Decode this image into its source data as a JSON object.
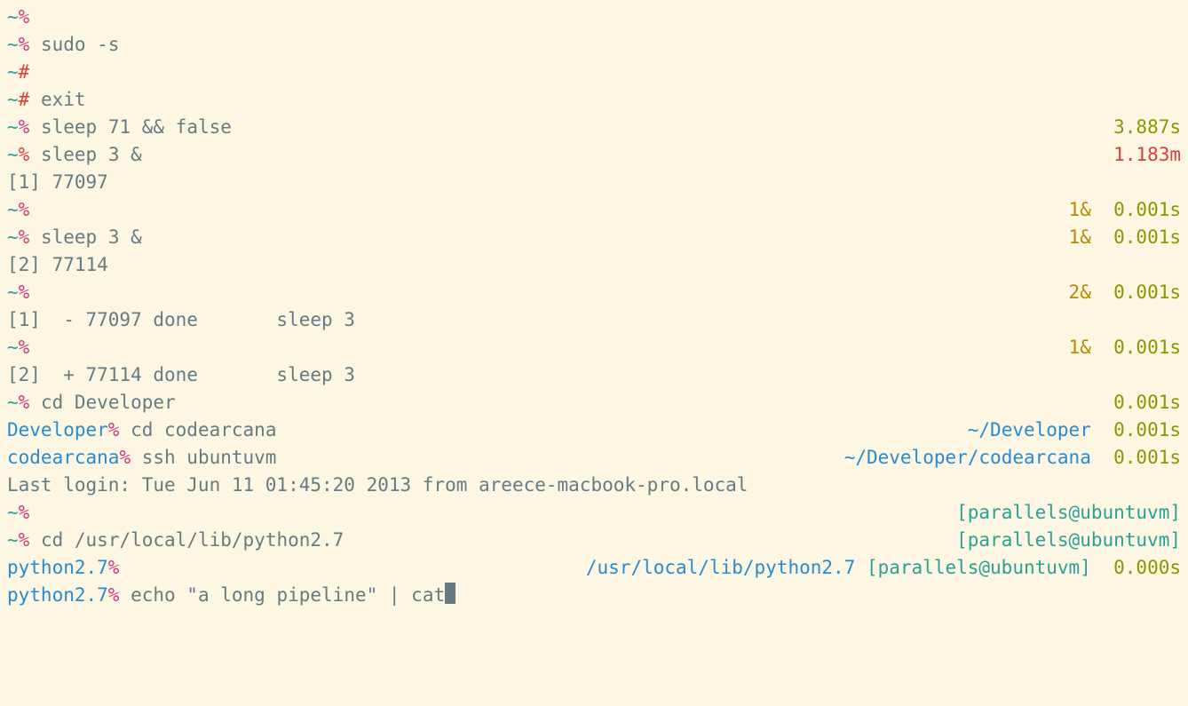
{
  "rows": [
    {
      "left": [
        {
          "t": "~",
          "c": "cyan"
        },
        {
          "t": "%",
          "c": "mag"
        }
      ],
      "right": []
    },
    {
      "left": [
        {
          "t": "~",
          "c": "cyan"
        },
        {
          "t": "%",
          "c": "mag"
        },
        {
          "t": " sudo -s",
          "c": "gray"
        }
      ],
      "right": []
    },
    {
      "left": [
        {
          "t": "~",
          "c": "cyan"
        },
        {
          "t": "#",
          "c": "red"
        }
      ],
      "right": []
    },
    {
      "left": [
        {
          "t": "~",
          "c": "cyan"
        },
        {
          "t": "#",
          "c": "red"
        },
        {
          "t": " exit",
          "c": "gray"
        }
      ],
      "right": []
    },
    {
      "left": [
        {
          "t": "~",
          "c": "cyan"
        },
        {
          "t": "%",
          "c": "mag"
        },
        {
          "t": " sleep 71 && false",
          "c": "gray"
        }
      ],
      "right": [
        {
          "t": "3.887s",
          "c": "olive"
        }
      ]
    },
    {
      "left": [
        {
          "t": "~",
          "c": "cyan"
        },
        {
          "t": "%",
          "c": "red"
        },
        {
          "t": " sleep 3 &",
          "c": "gray"
        }
      ],
      "right": [
        {
          "t": "1.183m",
          "c": "red"
        }
      ]
    },
    {
      "left": [
        {
          "t": "[1] 77097",
          "c": "gray"
        }
      ],
      "right": []
    },
    {
      "left": [
        {
          "t": "~",
          "c": "cyan"
        },
        {
          "t": "%",
          "c": "mag"
        }
      ],
      "right": [
        {
          "t": "1&",
          "c": "yellowish"
        },
        {
          "t": "  ",
          "c": "gray"
        },
        {
          "t": "0.001s",
          "c": "olive"
        }
      ]
    },
    {
      "left": [
        {
          "t": "~",
          "c": "cyan"
        },
        {
          "t": "%",
          "c": "mag"
        },
        {
          "t": " sleep 3 &",
          "c": "gray"
        }
      ],
      "right": [
        {
          "t": "1&",
          "c": "yellowish"
        },
        {
          "t": "  ",
          "c": "gray"
        },
        {
          "t": "0.001s",
          "c": "olive"
        }
      ]
    },
    {
      "left": [
        {
          "t": "[2] 77114",
          "c": "gray"
        }
      ],
      "right": []
    },
    {
      "left": [
        {
          "t": "~",
          "c": "cyan"
        },
        {
          "t": "%",
          "c": "mag"
        }
      ],
      "right": [
        {
          "t": "2&",
          "c": "yellowish"
        },
        {
          "t": "  ",
          "c": "gray"
        },
        {
          "t": "0.001s",
          "c": "olive"
        }
      ]
    },
    {
      "left": [
        {
          "t": "[1]  - 77097 done       sleep 3",
          "c": "gray"
        }
      ],
      "right": []
    },
    {
      "left": [
        {
          "t": "~",
          "c": "cyan"
        },
        {
          "t": "%",
          "c": "mag"
        }
      ],
      "right": [
        {
          "t": "1&",
          "c": "yellowish"
        },
        {
          "t": "  ",
          "c": "gray"
        },
        {
          "t": "0.001s",
          "c": "olive"
        }
      ]
    },
    {
      "left": [
        {
          "t": "[2]  + 77114 done       sleep 3",
          "c": "gray"
        }
      ],
      "right": []
    },
    {
      "left": [
        {
          "t": "~",
          "c": "cyan"
        },
        {
          "t": "%",
          "c": "mag"
        },
        {
          "t": " cd Developer",
          "c": "gray"
        }
      ],
      "right": [
        {
          "t": "0.001s",
          "c": "olive"
        }
      ]
    },
    {
      "left": [
        {
          "t": "Developer",
          "c": "blue"
        },
        {
          "t": "%",
          "c": "mag"
        },
        {
          "t": " cd codearcana",
          "c": "gray"
        }
      ],
      "right": [
        {
          "t": "~/Developer",
          "c": "blue"
        },
        {
          "t": "  ",
          "c": "gray"
        },
        {
          "t": "0.001s",
          "c": "olive"
        }
      ]
    },
    {
      "left": [
        {
          "t": "codearcana",
          "c": "blue"
        },
        {
          "t": "%",
          "c": "mag"
        },
        {
          "t": " ssh ubuntuvm",
          "c": "gray"
        }
      ],
      "right": [
        {
          "t": "~/Developer/codearcana",
          "c": "blue"
        },
        {
          "t": "  ",
          "c": "gray"
        },
        {
          "t": "0.001s",
          "c": "olive"
        }
      ]
    },
    {
      "left": [
        {
          "t": "Last login: Tue Jun 11 01:45:20 2013 from areece-macbook-pro.local",
          "c": "gray"
        }
      ],
      "right": []
    },
    {
      "left": [
        {
          "t": "~",
          "c": "cyan"
        },
        {
          "t": "%",
          "c": "mag"
        }
      ],
      "right": [
        {
          "t": "[parallels@ubuntuvm]",
          "c": "cyan"
        }
      ]
    },
    {
      "left": [
        {
          "t": "~",
          "c": "cyan"
        },
        {
          "t": "%",
          "c": "mag"
        },
        {
          "t": " cd /usr/local/lib/python2.7",
          "c": "gray"
        }
      ],
      "right": [
        {
          "t": "[parallels@ubuntuvm]",
          "c": "cyan"
        }
      ]
    },
    {
      "left": [
        {
          "t": "python2.7",
          "c": "blue"
        },
        {
          "t": "%",
          "c": "mag"
        }
      ],
      "right": [
        {
          "t": "/usr/local/lib/python2.7",
          "c": "blue"
        },
        {
          "t": " ",
          "c": "gray"
        },
        {
          "t": "[parallels@ubuntuvm]",
          "c": "cyan"
        },
        {
          "t": "  ",
          "c": "gray"
        },
        {
          "t": "0.000s",
          "c": "olive"
        }
      ]
    },
    {
      "left": [
        {
          "t": "python2.7",
          "c": "blue"
        },
        {
          "t": "%",
          "c": "mag"
        },
        {
          "t": " echo \"a long pipeline\" | cat",
          "c": "gray"
        }
      ],
      "right": [],
      "cursor": true
    }
  ]
}
